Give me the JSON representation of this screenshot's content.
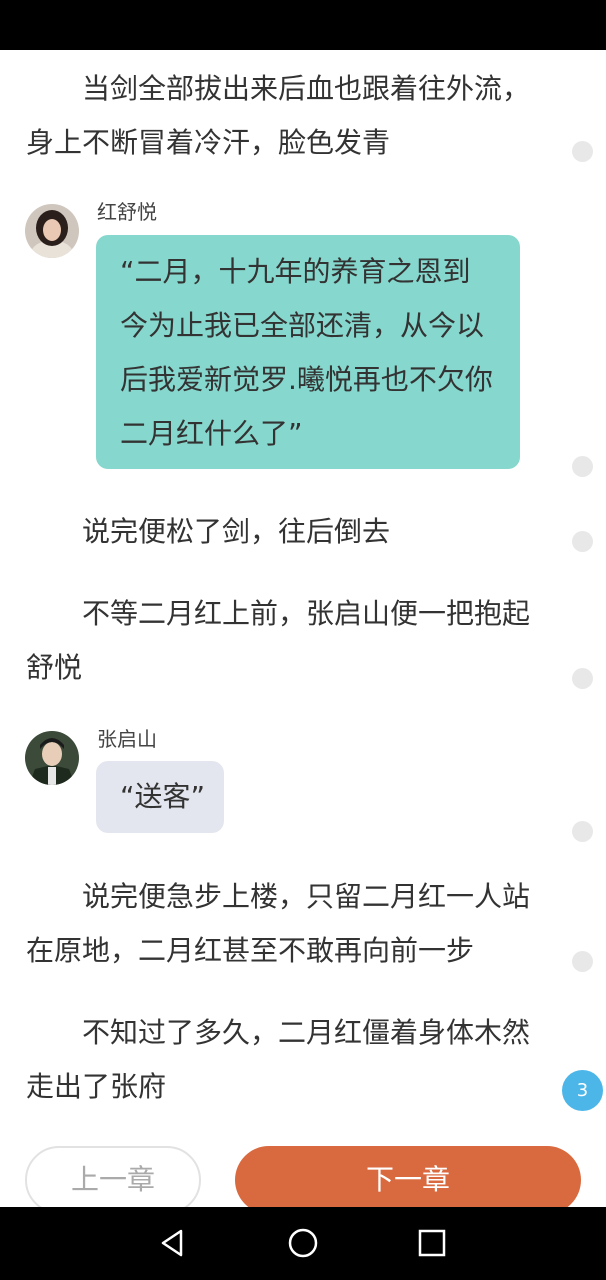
{
  "content": {
    "para1": "当剑全部拔出来后血也跟着往外流，身上不断冒着冷汗，脸色发青",
    "hong": {
      "speaker": "红舒悦",
      "message": "“二月，十九年的养育之恩到今为止我已全部还清，从今以后我爱新觉罗.曦悦再也不欠你二月红什么了”"
    },
    "para2": "说完便松了剑，往后倒去",
    "para3": "不等二月红上前，张启山便一把抱起舒悦",
    "zhang": {
      "speaker": "张启山",
      "message": "“送客”"
    },
    "para4": "说完便急步上楼，只留二月红一人站在原地，二月红甚至不敢再向前一步",
    "para5": "不知过了多久，二月红僵着身体木然走出了张府"
  },
  "comment_badge": "3",
  "footer": {
    "prev_label": "上一章",
    "next_label": "下一章"
  },
  "navigation": {
    "back": "back-icon",
    "home": "home-icon",
    "recents": "recents-icon"
  },
  "colors": {
    "accent": "#d9693e",
    "hong_bubble": "#86d7cd",
    "zhang_bubble": "#e3e6ee",
    "badge": "#4db6e8"
  }
}
